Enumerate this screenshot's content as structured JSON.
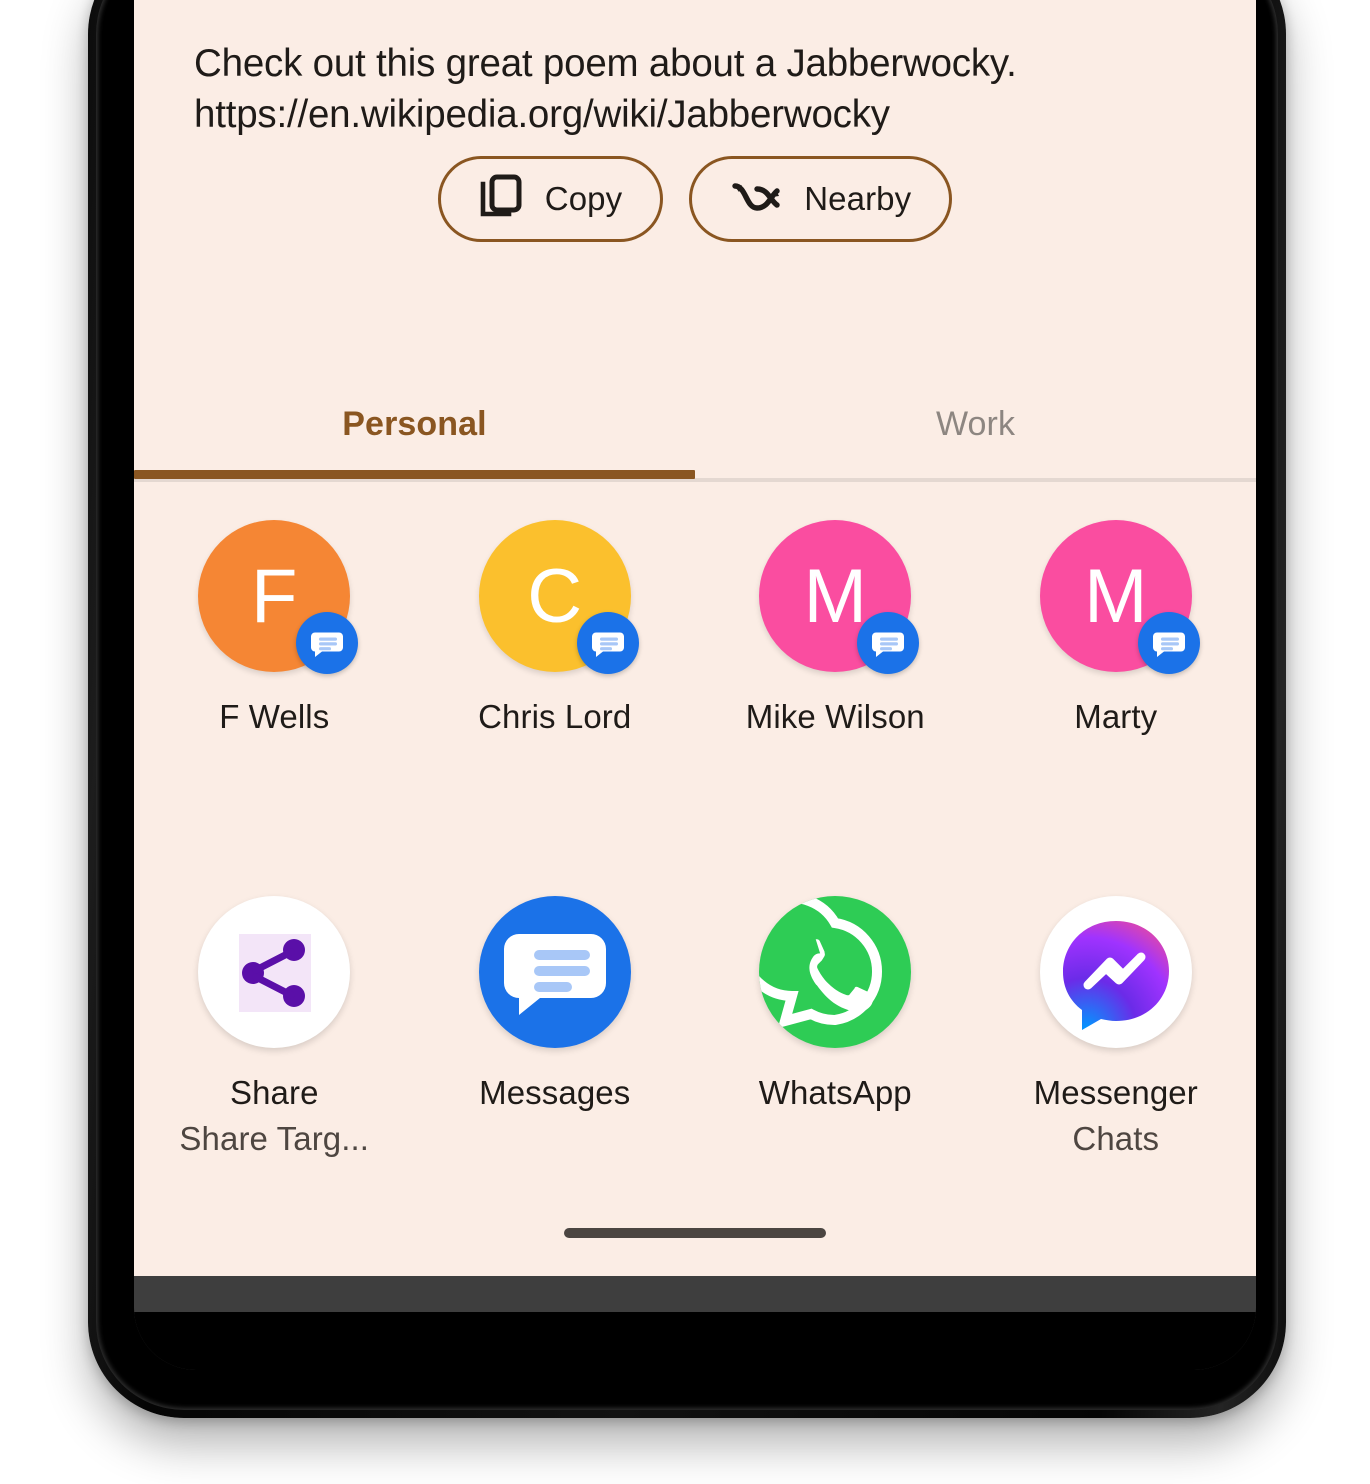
{
  "sheet": {
    "background_color": "#FBEDE5",
    "accent_color": "#8A5621",
    "drag_handle": "drag-handle"
  },
  "preview": {
    "text": "Check out this great poem about a Jabberwocky.\nhttps://en.wikipedia.org/wiki/Jabberwocky"
  },
  "actions": [
    {
      "label": "Copy",
      "icon": "copy-icon"
    },
    {
      "label": "Nearby",
      "icon": "nearby-share-icon"
    }
  ],
  "tabs": [
    {
      "label": "Personal",
      "active": true
    },
    {
      "label": "Work",
      "active": false
    }
  ],
  "contacts": [
    {
      "name": "F Wells",
      "initial": "F",
      "color": "#F58634",
      "badge": "messages-icon"
    },
    {
      "name": "Chris Lord",
      "initial": "C",
      "color": "#FBC02D",
      "badge": "messages-icon"
    },
    {
      "name": "Mike Wilson",
      "initial": "M",
      "color": "#FA4DA0",
      "badge": "messages-icon"
    },
    {
      "name": "Marty",
      "initial": "M",
      "color": "#FA4DA0",
      "badge": "messages-icon"
    }
  ],
  "apps": [
    {
      "label": "Share",
      "sublabel": "Share Targ...",
      "icon": "share-target-icon"
    },
    {
      "label": "Messages",
      "sublabel": "",
      "icon": "google-messages-icon"
    },
    {
      "label": "WhatsApp",
      "sublabel": "",
      "icon": "whatsapp-icon"
    },
    {
      "label": "Messenger",
      "sublabel": "Chats",
      "icon": "facebook-messenger-icon"
    }
  ]
}
